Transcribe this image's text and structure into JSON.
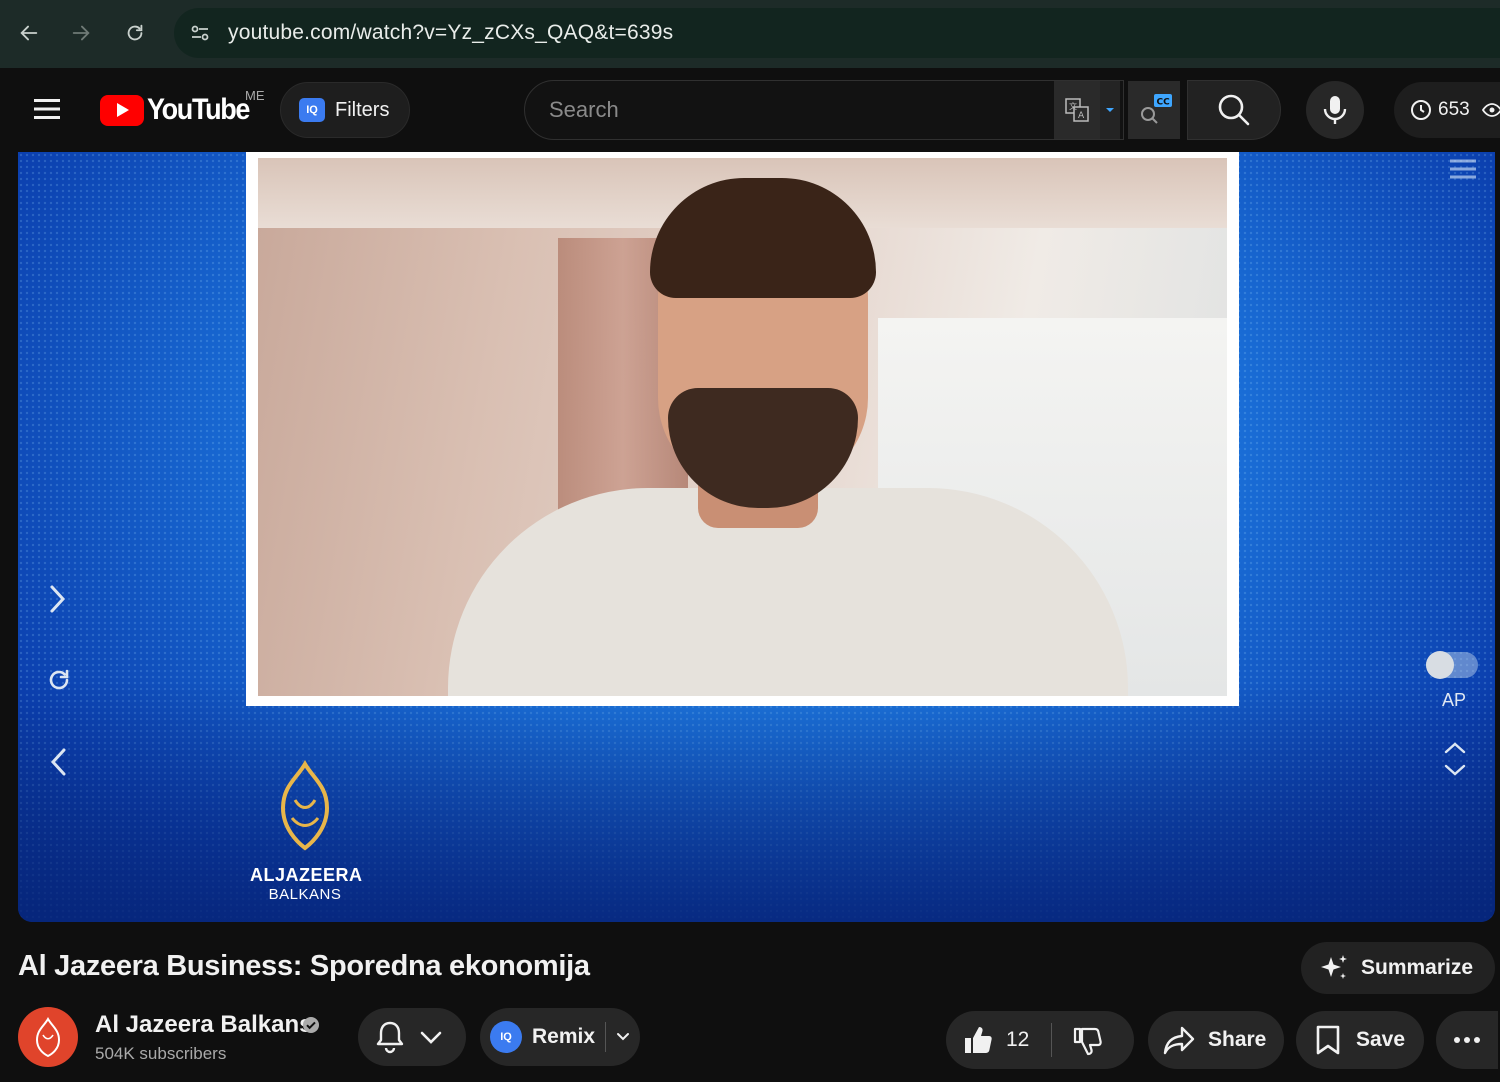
{
  "browser": {
    "url": "youtube.com/watch?v=Yz_zCXs_QAQ&t=639s"
  },
  "header": {
    "logo_text": "YouTube",
    "country_code": "ME",
    "filters_label": "Filters",
    "iq_badge": "IQ",
    "search_placeholder": "Search",
    "cc_badge": "CC",
    "counter_value": "653"
  },
  "player": {
    "brand_name": "ALJAZEERA",
    "brand_region": "BALKANS",
    "autoplay_label": "AP"
  },
  "video": {
    "title": "Al Jazeera Business: Sporedna ekonomija",
    "summarize_label": "Summarize"
  },
  "channel": {
    "name": "Al Jazeera Balkans",
    "subscribers": "504K subscribers"
  },
  "actions": {
    "remix_label": "Remix",
    "like_count": "12",
    "share_label": "Share",
    "save_label": "Save"
  },
  "colors": {
    "youtube_red": "#ff0000",
    "iq_blue": "#3b7bf0",
    "channel_avatar": "#e0442b"
  }
}
